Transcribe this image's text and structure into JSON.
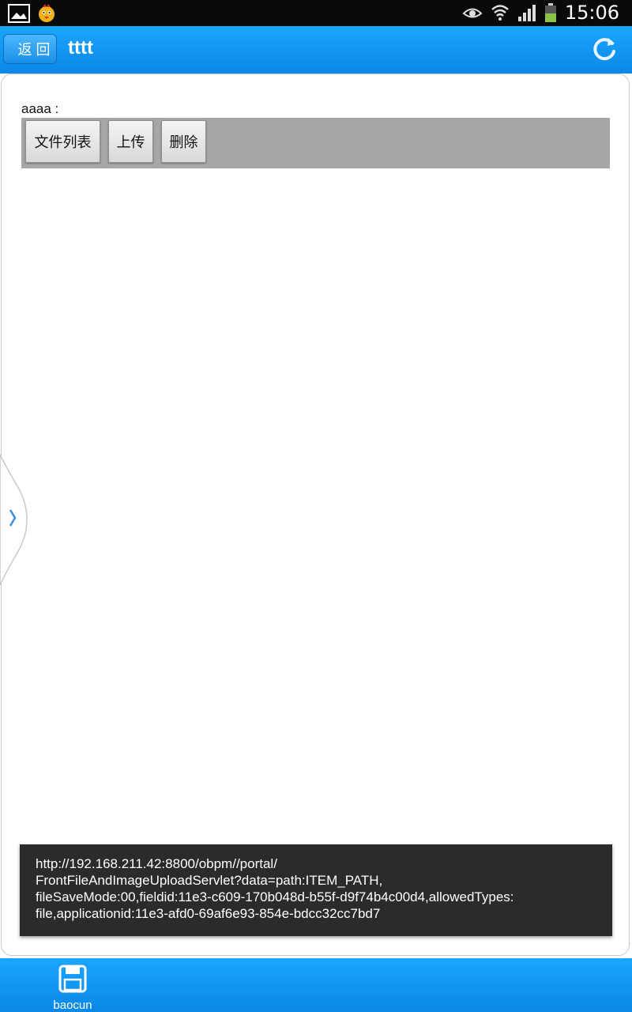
{
  "status_bar": {
    "time": "15:06",
    "icons": [
      "image-icon",
      "mascot-icon",
      "eye-icon",
      "wifi-icon",
      "signal-icon",
      "battery-icon"
    ]
  },
  "header": {
    "back_label": "返 回",
    "title": "tttt",
    "refresh_icon": "refresh-icon"
  },
  "form": {
    "field_label": "aaaa :",
    "buttons": {
      "file_list": "文件列表",
      "upload": "上传",
      "delete": "删除"
    }
  },
  "toast": {
    "lines": [
      "http://192.168.211.42:8800/obpm//portal/",
      "FrontFileAndImageUploadServlet?data=path:ITEM_PATH,",
      "fileSaveMode:00,fieldid:11e3-c609-170b048d-b55f-d9f74b4c00d4,allowedTypes:",
      "file,applicationid:11e3-afd0-69af6e93-854e-bdcc32cc7bd7"
    ]
  },
  "bottom_bar": {
    "save_label": "baocun",
    "save_icon": "save-icon"
  },
  "colors": {
    "accent": "#0b87e6",
    "status_bar": "#0a0a0a",
    "button_bar": "#a7a7a7",
    "toast_bg": "#2b2b2b"
  }
}
